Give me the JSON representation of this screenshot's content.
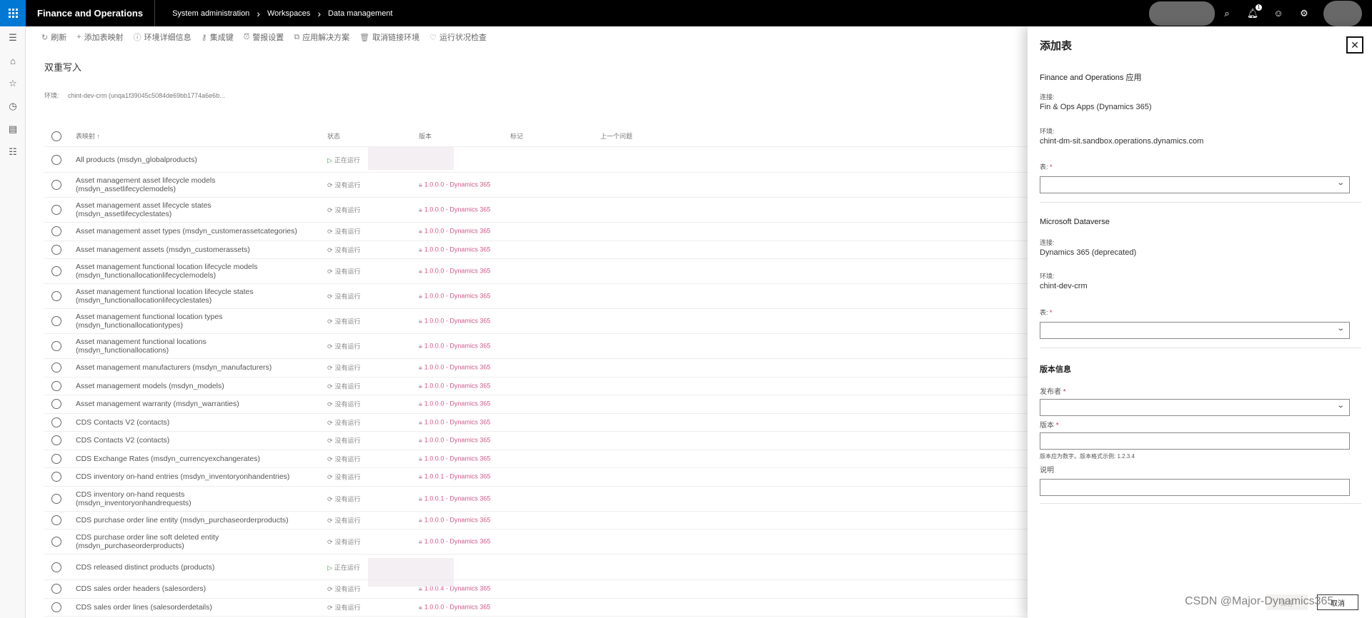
{
  "header": {
    "app_title": "Finance and Operations",
    "breadcrumbs": [
      "System administration",
      "Workspaces",
      "Data management"
    ],
    "notification_count": "1"
  },
  "toolbar": {
    "items": [
      {
        "label": "刷新",
        "icon": "refresh-icon"
      },
      {
        "label": "添加表映射",
        "icon": "add-icon"
      },
      {
        "label": "环境详细信息",
        "icon": "info-icon"
      },
      {
        "label": "集成键",
        "icon": "key-icon"
      },
      {
        "label": "警报设置",
        "icon": "alarm-icon"
      },
      {
        "label": "应用解决方案",
        "icon": "solution-icon"
      },
      {
        "label": "取消链接环境",
        "icon": "unlink-icon"
      },
      {
        "label": "运行状况检查",
        "icon": "health-icon"
      }
    ]
  },
  "page": {
    "title": "双重写入",
    "env_label": "环境:",
    "env_value": "chint-dev-crm (unqa1f39045c5084de69bb1774a6e6b..."
  },
  "grid": {
    "columns": [
      "表映射 ↑",
      "状态",
      "版本",
      "标记",
      "上一个问题"
    ],
    "rows": [
      {
        "name": "All products (msdyn_globalproducts)",
        "status": "正在运行",
        "running": true,
        "version": ""
      },
      {
        "name": "Asset management asset lifecycle models\n(msdyn_assetlifecyclemodels)",
        "status": "没有运行",
        "running": false,
        "version": "1.0.0.0 - Dynamics 365"
      },
      {
        "name": "Asset management asset lifecycle states\n(msdyn_assetlifecyclestates)",
        "status": "没有运行",
        "running": false,
        "version": "1.0.0.0 - Dynamics 365"
      },
      {
        "name": "Asset management asset types (msdyn_customerassetcategories)",
        "status": "没有运行",
        "running": false,
        "version": "1.0.0.0 - Dynamics 365"
      },
      {
        "name": "Asset management assets (msdyn_customerassets)",
        "status": "没有运行",
        "running": false,
        "version": "1.0.0.0 - Dynamics 365"
      },
      {
        "name": "Asset management functional location lifecycle models\n(msdyn_functionallocationlifecyclemodels)",
        "status": "没有运行",
        "running": false,
        "version": "1.0.0.0 - Dynamics 365"
      },
      {
        "name": "Asset management functional location lifecycle states\n(msdyn_functionallocationlifecyclestates)",
        "status": "没有运行",
        "running": false,
        "version": "1.0.0.0 - Dynamics 365"
      },
      {
        "name": "Asset management functional location types\n(msdyn_functionallocationtypes)",
        "status": "没有运行",
        "running": false,
        "version": "1.0.0.0 - Dynamics 365"
      },
      {
        "name": "Asset management functional locations\n(msdyn_functionallocations)",
        "status": "没有运行",
        "running": false,
        "version": "1.0.0.0 - Dynamics 365"
      },
      {
        "name": "Asset management manufacturers (msdyn_manufacturers)",
        "status": "没有运行",
        "running": false,
        "version": "1.0.0.0 - Dynamics 365"
      },
      {
        "name": "Asset management models (msdyn_models)",
        "status": "没有运行",
        "running": false,
        "version": "1.0.0.0 - Dynamics 365"
      },
      {
        "name": "Asset management warranty (msdyn_warranties)",
        "status": "没有运行",
        "running": false,
        "version": "1.0.0.0 - Dynamics 365"
      },
      {
        "name": "CDS Contacts V2 (contacts)",
        "status": "没有运行",
        "running": false,
        "version": "1.0.0.0 - Dynamics 365"
      },
      {
        "name": "CDS Contacts V2 (contacts)",
        "status": "没有运行",
        "running": false,
        "version": "1.0.0.0 - Dynamics 365"
      },
      {
        "name": "CDS Exchange Rates (msdyn_currencyexchangerates)",
        "status": "没有运行",
        "running": false,
        "version": "1.0.0.0 - Dynamics 365"
      },
      {
        "name": "CDS inventory on-hand entries (msdyn_inventoryonhandentries)",
        "status": "没有运行",
        "running": false,
        "version": "1.0.0.1 - Dynamics 365"
      },
      {
        "name": "CDS inventory on-hand requests\n(msdyn_inventoryonhandrequests)",
        "status": "没有运行",
        "running": false,
        "version": "1.0.0.1 - Dynamics 365"
      },
      {
        "name": "CDS purchase order line entity (msdyn_purchaseorderproducts)",
        "status": "没有运行",
        "running": false,
        "version": "1.0.0.0 - Dynamics 365"
      },
      {
        "name": "CDS purchase order line soft deleted entity\n(msdyn_purchaseorderproducts)",
        "status": "没有运行",
        "running": false,
        "version": "1.0.0.0 - Dynamics 365"
      },
      {
        "name": "CDS released distinct products (products)",
        "status": "正在运行",
        "running": true,
        "version": ""
      },
      {
        "name": "CDS sales order headers (salesorders)",
        "status": "没有运行",
        "running": false,
        "version": "1.0.0.4 - Dynamics 365"
      },
      {
        "name": "CDS sales order lines (salesorderdetails)",
        "status": "没有运行",
        "running": false,
        "version": "1.0.0.0 - Dynamics 365"
      }
    ]
  },
  "panel": {
    "title": "添加表",
    "fo_section": "Finance and Operations 应用",
    "fo_conn_label": "连接:",
    "fo_conn_value": "Fin & Ops Apps (Dynamics 365)",
    "fo_env_label": "环境:",
    "fo_env_value": "chint-dm-sit.sandbox.operations.dynamics.com",
    "fo_table_label": "表:",
    "dv_section": "Microsoft Dataverse",
    "dv_conn_label": "连接:",
    "dv_conn_value": "Dynamics 365 (deprecated)",
    "dv_env_label": "环境:",
    "dv_env_value": "chint-dev-crm",
    "dv_table_label": "表:",
    "version_section": "版本信息",
    "publisher_label": "发布者",
    "version_label": "版本",
    "version_hint": "版本应为数字。版本格式示例: 1.2.3.4",
    "description_label": "说明",
    "required_mark": "*",
    "save_label": "保存",
    "cancel_label": "取消"
  },
  "watermark": "CSDN @Major-Dynamics365"
}
